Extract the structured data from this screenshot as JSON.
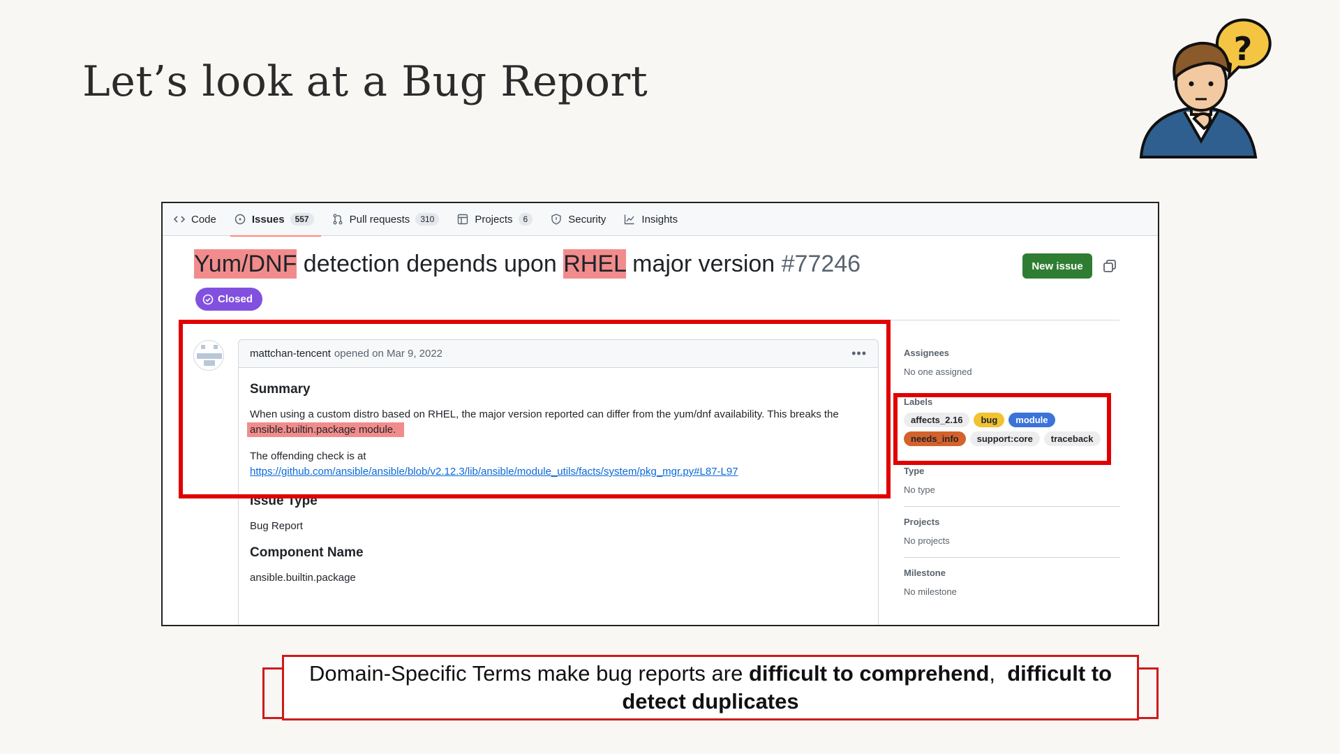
{
  "slide": {
    "title": "Let’s look at a Bug Report"
  },
  "tabs": [
    {
      "label": "Code",
      "icon": "code-icon"
    },
    {
      "label": "Issues",
      "count": "557",
      "icon": "issue-icon"
    },
    {
      "label": "Pull requests",
      "count": "310",
      "icon": "pull-request-icon"
    },
    {
      "label": "Projects",
      "count": "6",
      "icon": "table-icon"
    },
    {
      "label": "Security",
      "icon": "shield-icon"
    },
    {
      "label": "Insights",
      "icon": "graph-icon"
    }
  ],
  "issue": {
    "title_hl1": "Yum/DNF",
    "title_mid": " detection depends upon ",
    "title_hl2": "RHEL",
    "title_end": " major version",
    "number": "#77246",
    "status": "Closed",
    "new_issue_label": "New issue"
  },
  "comment": {
    "author": "mattchan-tencent",
    "meta": "opened on Mar 9, 2022",
    "summary_heading": "Summary",
    "summary_text": "When using a custom distro based on RHEL, the major version reported can differ from the yum/dnf availability. This breaks the",
    "summary_hl": "ansible.builtin.package module.",
    "offending_text": "The offending check is at",
    "link": "https://github.com/ansible/ansible/blob/v2.12.3/lib/ansible/module_utils/facts/system/pkg_mgr.py#L87-L97",
    "issue_type_heading": "Issue Type",
    "issue_type_value": "Bug Report",
    "component_heading": "Component Name",
    "component_value": "ansible.builtin.package"
  },
  "sidebar": {
    "assignees_heading": "Assignees",
    "assignees_value": "No one assigned",
    "labels_heading": "Labels",
    "labels": [
      {
        "text": "affects_2.16",
        "bg": "#ededed",
        "fg": "#1f2328"
      },
      {
        "text": "bug",
        "bg": "#f1c232",
        "fg": "#1f2328"
      },
      {
        "text": "module",
        "bg": "#3b73d9",
        "fg": "#ffffff"
      },
      {
        "text": "needs_info",
        "bg": "#d4622c",
        "fg": "#1f2328"
      },
      {
        "text": "support:core",
        "bg": "#ededed",
        "fg": "#1f2328"
      },
      {
        "text": "traceback",
        "bg": "#ededed",
        "fg": "#1f2328"
      }
    ],
    "type_heading": "Type",
    "type_value": "No type",
    "projects_heading": "Projects",
    "projects_value": "No projects",
    "milestone_heading": "Milestone",
    "milestone_value": "No milestone"
  },
  "caption": {
    "plain": "Domain-Specific Terms make bug reports are ",
    "bold1": "difficult to comprehend",
    "sep": ",  ",
    "bold2": "difficult to detect duplicates"
  },
  "colors": {
    "highlight": "#f28c8c",
    "redbox": "#e00000",
    "closed": "#8250df",
    "new_issue": "#2e7d32"
  }
}
